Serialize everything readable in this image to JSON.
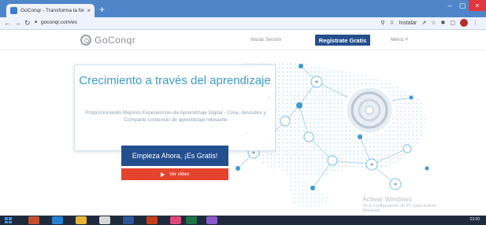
{
  "browser": {
    "tab_title": "GoConqr - Transforma la forma e",
    "tab_close": "×",
    "new_tab": "+",
    "url": "goconqr.com/es",
    "install_label": "Instalar",
    "window_controls": [
      "–",
      "▢",
      "×"
    ],
    "nav_icons": [
      "arrow-left-icon",
      "arrow-right-icon",
      "reload-icon"
    ]
  },
  "site": {
    "logo_text": "GoConqr",
    "nav": {
      "login": "Iniciar Sesión",
      "register": "Regístrate Gratis",
      "menu": "Menú"
    }
  },
  "hero": {
    "title": "Crecimiento a través del aprendizaje",
    "subtitle": "Proporcionando Mejores Experiencias de Aprendizaje Digital - Crea, descubre y Comparte contenido de aprendizaje relevante",
    "cta": "Empieza Ahora, ¡Es Gratis!",
    "video": "Ver video"
  },
  "watermark": {
    "title": "Activar Windows",
    "subtitle": "Ve a Configuración de PC para activar Windows."
  },
  "taskbar": {
    "clock": "23:00"
  },
  "colors": {
    "brand_blue": "#234f8e",
    "accent_blue": "#3e9ad0",
    "video_red": "#e4442e",
    "chrome_blue": "#4f86c9"
  }
}
